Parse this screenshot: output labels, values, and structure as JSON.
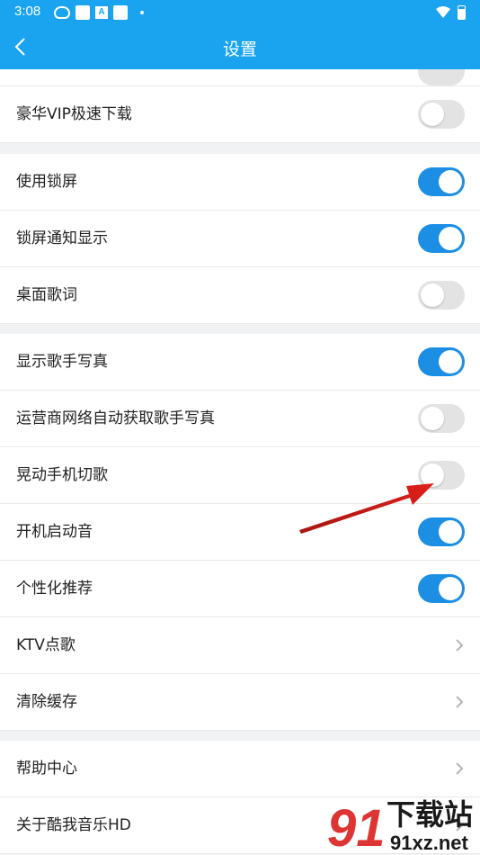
{
  "status_bar": {
    "time": "3:08",
    "notif_letter": "A"
  },
  "header": {
    "title": "设置"
  },
  "rows": [
    {
      "label": "豪华VIP极速下载",
      "type": "toggle",
      "on": false
    },
    {
      "label": "使用锁屏",
      "type": "toggle",
      "on": true
    },
    {
      "label": "锁屏通知显示",
      "type": "toggle",
      "on": true
    },
    {
      "label": "桌面歌词",
      "type": "toggle",
      "on": false
    },
    {
      "label": "显示歌手写真",
      "type": "toggle",
      "on": true
    },
    {
      "label": "运营商网络自动获取歌手写真",
      "type": "toggle",
      "on": false
    },
    {
      "label": "晃动手机切歌",
      "type": "toggle",
      "on": false
    },
    {
      "label": "开机启动音",
      "type": "toggle",
      "on": true
    },
    {
      "label": "个性化推荐",
      "type": "toggle",
      "on": true
    },
    {
      "label": "KTV点歌",
      "type": "link"
    },
    {
      "label": "清除缓存",
      "type": "link"
    },
    {
      "label": "帮助中心",
      "type": "link"
    },
    {
      "label": "关于酷我音乐HD",
      "type": "link"
    }
  ],
  "watermark": {
    "text": "下载站",
    "url_text": "91xz.net",
    "logo_digits": "91"
  },
  "colors": {
    "accent": "#1aa3ef",
    "toggle_on": "#1c8fe5",
    "toggle_off": "#e3e3e3",
    "annotation": "#e0201b"
  }
}
